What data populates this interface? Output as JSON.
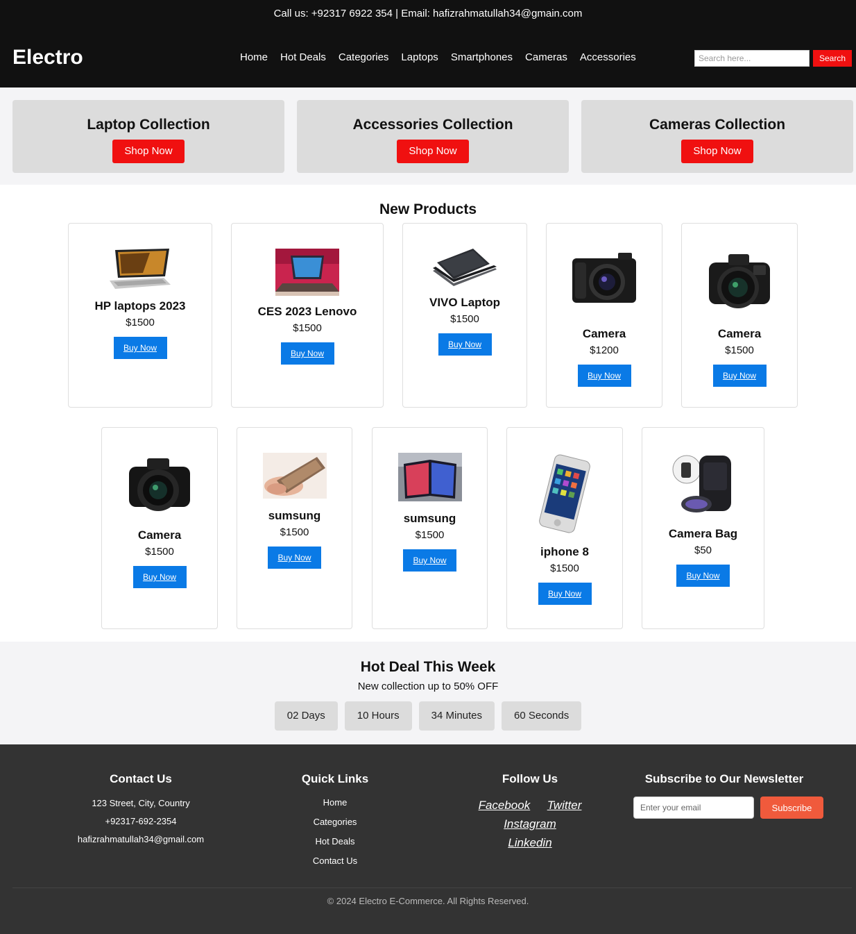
{
  "topbar": {
    "text": "Call us: +92317 6922 354 | Email: hafizrahmatullah34@gmain.com"
  },
  "header": {
    "logo": "Electro",
    "nav": [
      "Home",
      "Hot Deals",
      "Categories",
      "Laptops",
      "Smartphones",
      "Cameras",
      "Accessories"
    ],
    "search_placeholder": "Search here...",
    "search_label": "Search"
  },
  "collections": [
    {
      "title": "Laptop Collection",
      "button": "Shop Now"
    },
    {
      "title": "Accessories Collection",
      "button": "Shop Now"
    },
    {
      "title": "Cameras Collection",
      "button": "Shop Now"
    }
  ],
  "products_title": "New Products",
  "products": [
    {
      "name": "HP laptops 2023",
      "price": "$1500",
      "button": "Buy Now",
      "icon": "laptop-image"
    },
    {
      "name": "CES 2023 Lenovo",
      "price": "$1500",
      "button": "Buy Now",
      "icon": "laptop-image"
    },
    {
      "name": "VIVO Laptop",
      "price": "$1500",
      "button": "Buy Now",
      "icon": "laptop-image"
    },
    {
      "name": "Camera",
      "price": "$1200",
      "button": "Buy Now",
      "icon": "camera-image"
    },
    {
      "name": "Camera",
      "price": "$1500",
      "button": "Buy Now",
      "icon": "camera-image"
    },
    {
      "name": "Camera",
      "price": "$1500",
      "button": "Buy Now",
      "icon": "camera-image"
    },
    {
      "name": "sumsung",
      "price": "$1500",
      "button": "Buy Now",
      "icon": "phone-image"
    },
    {
      "name": "sumsung",
      "price": "$1500",
      "button": "Buy Now",
      "icon": "tablet-image"
    },
    {
      "name": "iphone 8",
      "price": "$1500",
      "button": "Buy Now",
      "icon": "phone-image"
    },
    {
      "name": "Camera Bag",
      "price": "$50",
      "button": "Buy Now",
      "icon": "bag-image"
    }
  ],
  "hotdeal": {
    "title": "Hot Deal This Week",
    "subtitle": "New collection up to 50% OFF",
    "countdown": [
      "02 Days",
      "10 Hours",
      "34 Minutes",
      "60 Seconds"
    ]
  },
  "footer": {
    "contact": {
      "title": "Contact Us",
      "address": "123 Street, City, Country",
      "phone": "+92317-692-2354",
      "email": "hafizrahmatullah34@gmail.com"
    },
    "quick_links": {
      "title": "Quick Links",
      "links": [
        "Home",
        "Categories",
        "Hot Deals",
        "Contact Us"
      ]
    },
    "follow": {
      "title": "Follow Us",
      "links": [
        "Facebook",
        "Twitter",
        "Instagram",
        "Linkedin"
      ]
    },
    "newsletter": {
      "title": "Subscribe to Our Newsletter",
      "placeholder": "Enter your email",
      "button": "Subscribe"
    },
    "copyright": "© 2024 Electro E-Commerce. All Rights Reserved."
  },
  "colors": {
    "accent_red": "#f01010",
    "buy_blue": "#0a7ae6",
    "subscribe_orange": "#f05a3c",
    "dark": "#111111",
    "footer": "#333333"
  }
}
